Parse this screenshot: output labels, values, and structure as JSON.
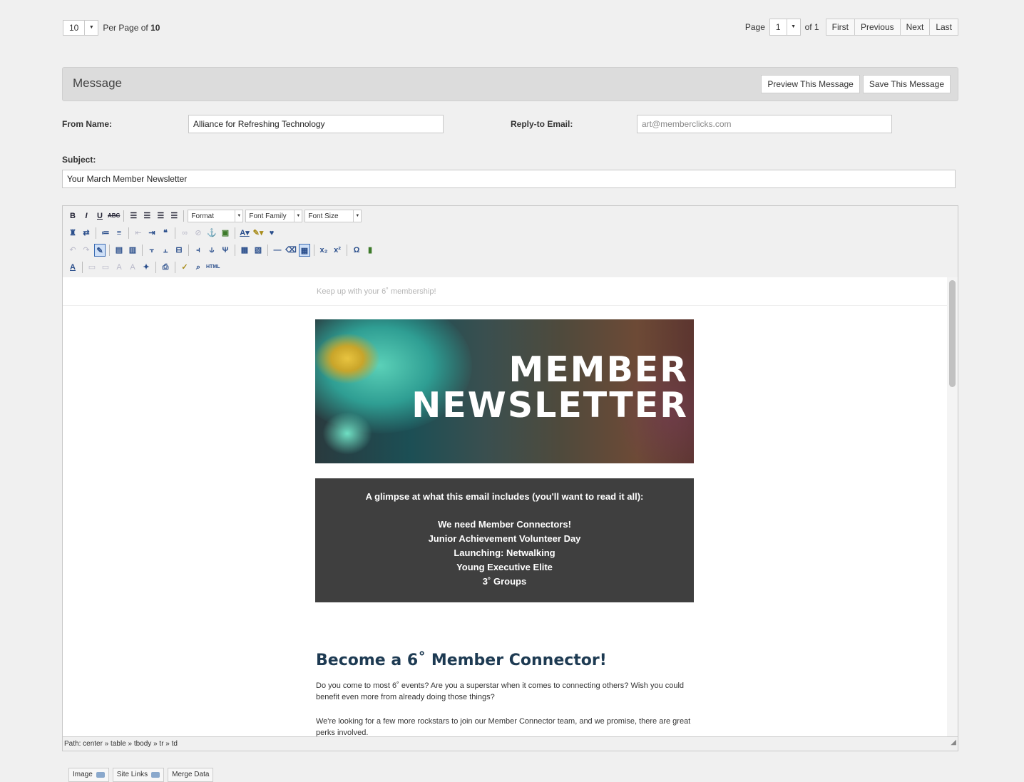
{
  "pagination": {
    "per_page_value": "10",
    "per_page_text": "Per Page of",
    "total": "10",
    "page_label": "Page",
    "page_value": "1",
    "of_label": "of 1",
    "buttons": [
      "First",
      "Previous",
      "Next",
      "Last"
    ]
  },
  "message_panel": {
    "title": "Message",
    "preview_label": "Preview This Message",
    "save_label": "Save This Message"
  },
  "form": {
    "from_name_label": "From Name:",
    "from_name_value": "Alliance for Refreshing Technology",
    "reply_to_label": "Reply-to Email:",
    "reply_to_value": "art@memberclicks.com",
    "subject_label": "Subject:",
    "subject_value": "Your March Member Newsletter"
  },
  "toolbar": {
    "format_label": "Format",
    "font_family_label": "Font Family",
    "font_size_label": "Font Size",
    "bold": "B",
    "italic": "I",
    "underline": "U",
    "strike": "ABC",
    "html": "HTML"
  },
  "email_content": {
    "preheader": "Keep up with your 6˚ membership!",
    "hero_line1": "MEMBER",
    "hero_line2": "NEWSLETTER",
    "glimpse_intro": "A glimpse at what this email includes (you'll want to read it all):",
    "glimpse_items": [
      "We need Member Connectors!",
      "Junior Achievement Volunteer Day",
      "Launching: Netwalking",
      "Young Executive Elite",
      "3˚ Groups"
    ],
    "section_title": "Become a 6˚ Member Connector!",
    "para1": "Do you come to most 6˚ events? Are you a superstar when it comes to connecting others? Wish you could benefit even more from already doing those things?",
    "para2": "We're looking for a few more rockstars to join our Member Connector team, and we promise, there are great perks involved."
  },
  "path_bar": "Path: center » table » tbody » tr » td",
  "bottom_buttons": {
    "image": "Image",
    "site_links": "Site Links",
    "merge_data": "Merge Data"
  }
}
